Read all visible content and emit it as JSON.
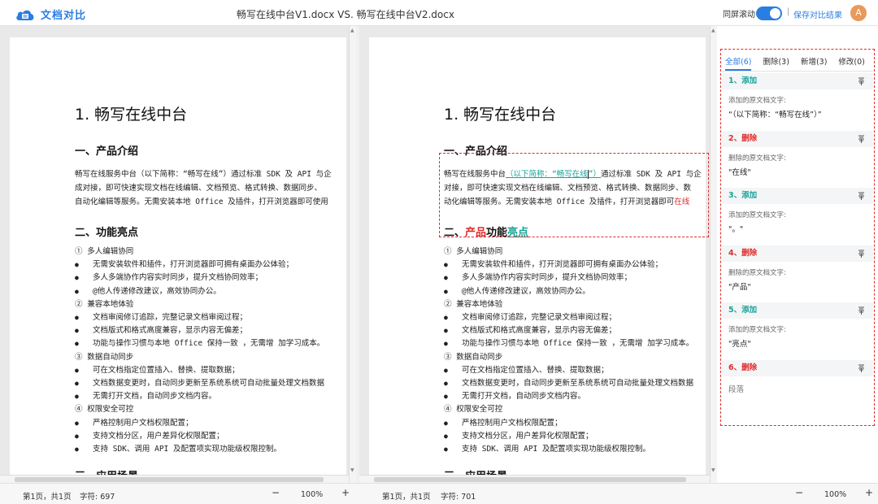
{
  "app": {
    "name": "文档对比"
  },
  "header": {
    "title": "畅写在线中台V1.docx VS. 畅写在线中台V2.docx",
    "sync_label": "同屏滚动",
    "sync_on": true,
    "separator": "|",
    "save_label": "保存对比结果",
    "avatar_letter": "A",
    "accent": "#2a7de1"
  },
  "doc_left": {
    "h1": "1. 畅写在线中台",
    "intro_heading": "一、产品介绍",
    "intro_lines": [
      "畅写在线服务中台（以下简称：“畅写在线”）通过标准 SDK 及 API 与企",
      "成对接，即可快速实现文档在线编辑、文档预览、格式转换、数据同步、",
      "自动化编辑等服务。无需安装本地 Office 及插件，打开浏览器即可使用"
    ],
    "feature_heading": "二、功能亮点"
  },
  "doc_right": {
    "h1": "1. 畅写在线中台",
    "intro_heading": "一、产品介绍",
    "intro_line1_pre": "畅写在线服务中台",
    "intro_line1_ins": "（以下简称：“畅写在线",
    "intro_line1_ins2": "”）",
    "intro_line1_post": "通过标准 SDK 及 API 与企",
    "intro_line2": "对接，即可快速实现文档在线编辑、文档预览、格式转换、数据同步、数",
    "intro_line3_pre": "动化编辑等服务。无需安装本地 Office 及插件，打开浏览器即可",
    "intro_line3_del": "在线",
    "feature_pre": "二、",
    "feature_del": "产品",
    "feature_mid": "功能",
    "feature_ins": "亮点"
  },
  "features": [
    {
      "type": "section",
      "text": "① 多人编辑协同"
    },
    {
      "type": "bullet",
      "text": "无需安装软件和插件，打开浏览器即可拥有桌面办公体验；"
    },
    {
      "type": "bullet",
      "text": "多人多端协作内容实时同步，提升文档协同效率；"
    },
    {
      "type": "bullet",
      "text": "@他人传递修改建议，高效协同办公。"
    },
    {
      "type": "section",
      "text": "② 兼容本地体验"
    },
    {
      "type": "bullet",
      "text": "文档审阅修订追踪，完整记录文档审阅过程；"
    },
    {
      "type": "bullet",
      "text": "文档版式和格式高度兼容，显示内容无偏差；"
    },
    {
      "type": "bullet",
      "text": "功能与操作习惯与本地 Office 保持一致 ，无需增 加学习成本。"
    },
    {
      "type": "section",
      "text": "③ 数据自动同步"
    },
    {
      "type": "bullet",
      "text": "可在文档指定位置插入、替换、提取数据；"
    },
    {
      "type": "bullet",
      "text": "文档数据变更时，自动同步更新至系统系统可自动批量处理文档数据"
    },
    {
      "type": "bullet",
      "text": "无需打开文档，自动同步文档内容。"
    },
    {
      "type": "section",
      "text": "④ 权限安全可控"
    },
    {
      "type": "bullet",
      "text": "严格控制用户文档权限配置；"
    },
    {
      "type": "bullet",
      "text": "支持文档分区，用户差异化权限配置；"
    },
    {
      "type": "bullet",
      "text": "支持 SDK、调用 API 及配置项实现功能级权限控制。"
    }
  ],
  "scenario_heading": "三、应用场景",
  "sidebar": {
    "tabs": [
      "全部(6)",
      "删除(3)",
      "新增(3)",
      "修改(0)"
    ],
    "changes": [
      {
        "title": "1、添加",
        "kind": "add",
        "label": "添加的原文档文字:",
        "text": "“（以下简称：“畅写在线”）”"
      },
      {
        "title": "2、删除",
        "kind": "delete",
        "label": "删除的原文档文字:",
        "text": "\"在线\""
      },
      {
        "title": "3、添加",
        "kind": "add",
        "label": "添加的原文档文字:",
        "text": "\"。\""
      },
      {
        "title": "4、删除",
        "kind": "delete",
        "label": "删除的原文档文字:",
        "text": "\"产品\""
      },
      {
        "title": "5、添加",
        "kind": "add",
        "label": "添加的原文档文字:",
        "text": "\"亮点\""
      },
      {
        "title": "6、删除",
        "kind": "delete",
        "label": "",
        "text": "段落"
      }
    ]
  },
  "status": {
    "left_page": "第1页，共1页",
    "left_chars": "字符: 697",
    "left_zoom": "100%",
    "right_page": "第1页，共1页",
    "right_chars": "字符: 701",
    "right_zoom": "100%",
    "minus": "−",
    "plus": "+"
  },
  "colors": {
    "insert": "#17a397",
    "delete": "#e02b2b"
  }
}
